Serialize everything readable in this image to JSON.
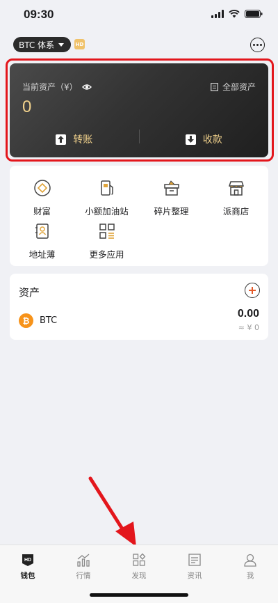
{
  "status_bar": {
    "time": "09:30"
  },
  "header": {
    "chain_selector": "BTC 体系",
    "hd_badge": "HD"
  },
  "asset_card": {
    "label": "当前资产（¥）",
    "all_assets_label": "全部资产",
    "value": "0",
    "transfer_label": "转账",
    "receive_label": "收款"
  },
  "apps": [
    {
      "label": "财富",
      "icon": "diamond-icon"
    },
    {
      "label": "小额加油站",
      "icon": "fuel-pump-icon"
    },
    {
      "label": "碎片整理",
      "icon": "box-icon"
    },
    {
      "label": "派商店",
      "icon": "store-icon"
    },
    {
      "label": "地址薄",
      "icon": "address-book-icon"
    },
    {
      "label": "更多应用",
      "icon": "grid-icon"
    }
  ],
  "assets": {
    "title": "资产",
    "items": [
      {
        "symbol": "BTC",
        "amount": "0.00",
        "fiat": "≈ ¥ 0"
      }
    ]
  },
  "tabs": [
    {
      "label": "钱包",
      "icon": "wallet-hd-icon",
      "active": true
    },
    {
      "label": "行情",
      "icon": "chart-icon",
      "active": false
    },
    {
      "label": "发现",
      "icon": "discover-icon",
      "active": false
    },
    {
      "label": "资讯",
      "icon": "news-icon",
      "active": false
    },
    {
      "label": "我",
      "icon": "profile-icon",
      "active": false
    }
  ],
  "colors": {
    "highlight": "#e3161c",
    "gold": "#f2d28c",
    "btc": "#f7931a",
    "annotation_arrow": "#e3161c"
  }
}
